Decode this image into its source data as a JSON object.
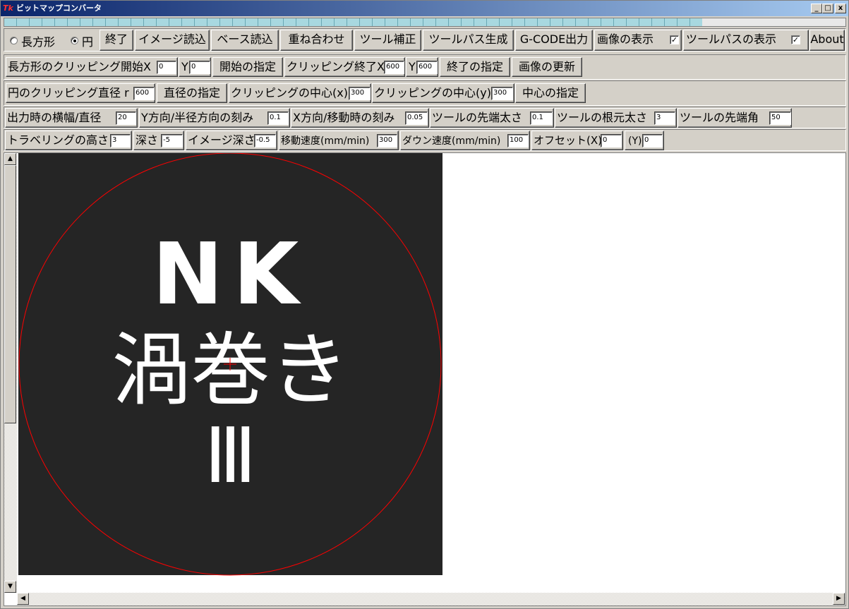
{
  "window": {
    "title": "ビットマップコンバータ",
    "app_icon": "Tk",
    "min": "_",
    "max": "□",
    "close": "x"
  },
  "progress": {
    "fill_fraction": 0.83
  },
  "row1": {
    "radio_rect": "長方形",
    "radio_circle": "円",
    "selected_shape": "circle",
    "btn_exit": "終了",
    "btn_image_load": "イメージ読込",
    "btn_base_load": "ベース読込",
    "btn_overlay": "重ね合わせ",
    "btn_tool_correct": "ツール補正",
    "btn_toolpath_gen": "ツールパス生成",
    "btn_gcode": "G-CODE出力",
    "chk_show_image": "画像の表示",
    "chk_show_image_checked": "✓",
    "chk_show_toolpath": "ツールパスの表示",
    "chk_show_toolpath_checked": "✓",
    "btn_about": "About"
  },
  "row2": {
    "lbl_rect_clip_start": "長方形のクリッピング開始X",
    "start_x": "0",
    "lbl_y1": "Y",
    "start_y": "0",
    "btn_start": "開始の指定",
    "lbl_clip_end": "クリッピング終了X",
    "end_x": "600",
    "lbl_y2": "Y",
    "end_y": "600",
    "btn_end": "終了の指定",
    "btn_update": "画像の更新"
  },
  "row3": {
    "lbl_circle_diam": "円のクリッピング直径 r",
    "diameter": "600",
    "btn_diam": "直径の指定",
    "lbl_center_x": "クリッピングの中心(x)",
    "center_x": "300",
    "lbl_center_y": "クリッピングの中心(y)",
    "center_y": "300",
    "btn_center": "中心の指定"
  },
  "row4": {
    "lbl_width": "出力時の横幅/直径",
    "width": "20",
    "lbl_ystep": "Y方向/半径方向の刻み",
    "ystep": "0.1",
    "lbl_xstep": "X方向/移動時の刻み",
    "xstep": "0.05",
    "lbl_tip": "ツールの先端太さ",
    "tip": "0.1",
    "lbl_root": "ツールの根元太さ",
    "root": "3",
    "lbl_angle": "ツールの先端角",
    "angle": "50"
  },
  "row5": {
    "lbl_travel": "トラベリングの高さ",
    "travel": "3",
    "lbl_depth": "深さ",
    "depth": "-5",
    "lbl_img_depth": "イメージ深さ",
    "img_depth": "-0.5",
    "lbl_move_speed": "移動速度(mm/min)",
    "move_speed": "300",
    "lbl_down_speed": "ダウン速度(mm/min)",
    "down_speed": "100",
    "lbl_offx": "オフセット(X)",
    "offx": "0",
    "lbl_offy": "(Y)",
    "offy": "0"
  },
  "image": {
    "line1": "NK",
    "line2": "渦巻き",
    "line3": "Ⅲ",
    "bg": "#252525",
    "clip_color": "#ff0000"
  },
  "scroll": {
    "up": "▲",
    "down": "▼",
    "left": "◀",
    "right": "▶"
  }
}
